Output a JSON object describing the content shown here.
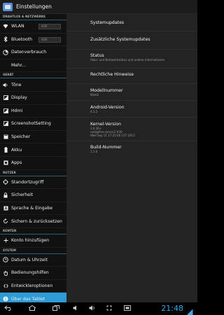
{
  "actionbar": {
    "title": "Einstellungen"
  },
  "sidebar": {
    "sections": {
      "wireless": "DRAHTLOS & NETZWERKE",
      "device": "GERÄT",
      "users": "NUTZER",
      "accounts": "KONTEN",
      "system": "SYSTEM"
    },
    "wlan": {
      "label": "WLAN",
      "toggle": "AUS"
    },
    "bluetooth": {
      "label": "Bluetooth",
      "toggle": "AUS"
    },
    "items": {
      "data": "Datenverbrauch",
      "more": "Mehr...",
      "sounds": "Töne",
      "display": "Display",
      "hdmi": "Hdmi",
      "screenshot": "ScreenshotSetting",
      "storage": "Speicher",
      "battery": "Akku",
      "apps": "Apps",
      "location": "Standortzugriff",
      "security": "Sicherheit",
      "language": "Sprache & Eingabe",
      "backup": "Sichern & zurücksetzen",
      "add_account": "Konto hinzufügen",
      "datetime": "Datum & Uhrzeit",
      "accessibility": "Bedienungshilfen",
      "developer": "Entwickleroptionen",
      "about": "Über das Tablet"
    }
  },
  "content": {
    "system_updates": "Systemupdates",
    "extra_updates": "Zusätzliche Systemupdates",
    "status": {
      "title": "Status",
      "sub": "Akku- und Netzwerkstatus und andere Informationen"
    },
    "legal": "Rechtliche Hinweise",
    "model": {
      "title": "Modellnummer",
      "value": "8Vell2"
    },
    "android": {
      "title": "Android-Version",
      "value": "4.2.2"
    },
    "kernel": {
      "title": "Kernel-Version",
      "value1": "3.0.36+",
      "value2": "root@five-server2 #30",
      "value3": "Wed Sep 11 17:25:06 CST 2013"
    },
    "build": {
      "title": "Build-Nummer",
      "value": "1.1.0"
    }
  },
  "navbar": {
    "clock": "21:48"
  }
}
